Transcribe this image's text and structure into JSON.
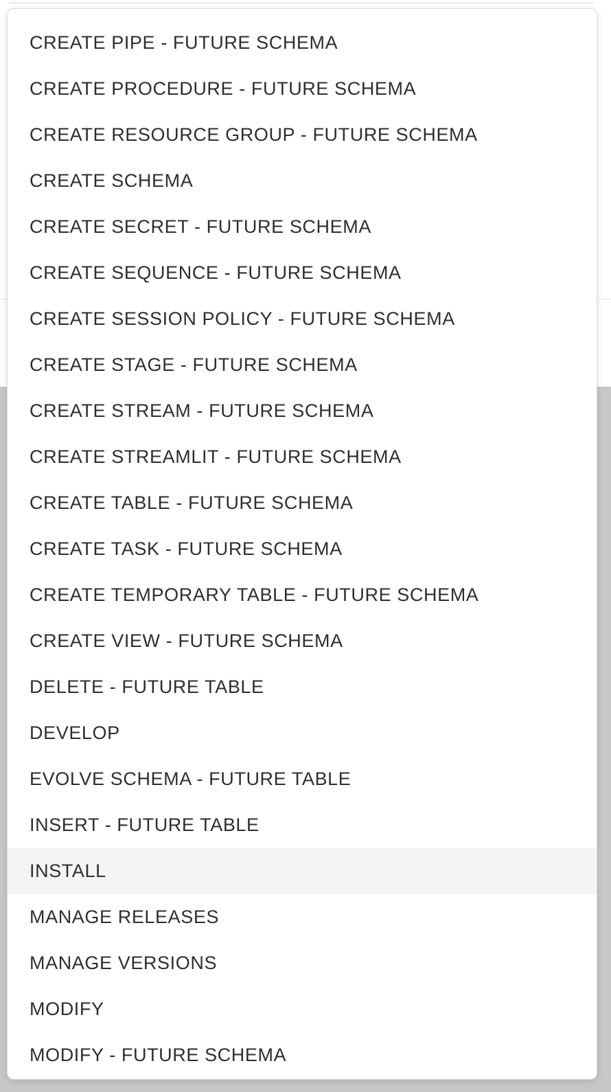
{
  "dropdown": {
    "highlighted_index": 18,
    "items": [
      {
        "label": "CREATE PIPE - FUTURE SCHEMA"
      },
      {
        "label": "CREATE PROCEDURE - FUTURE SCHEMA"
      },
      {
        "label": "CREATE RESOURCE GROUP - FUTURE SCHEMA"
      },
      {
        "label": "CREATE SCHEMA"
      },
      {
        "label": "CREATE SECRET - FUTURE SCHEMA"
      },
      {
        "label": "CREATE SEQUENCE - FUTURE SCHEMA"
      },
      {
        "label": "CREATE SESSION POLICY - FUTURE SCHEMA"
      },
      {
        "label": "CREATE STAGE - FUTURE SCHEMA"
      },
      {
        "label": "CREATE STREAM - FUTURE SCHEMA"
      },
      {
        "label": "CREATE STREAMLIT - FUTURE SCHEMA"
      },
      {
        "label": "CREATE TABLE - FUTURE SCHEMA"
      },
      {
        "label": "CREATE TASK - FUTURE SCHEMA"
      },
      {
        "label": "CREATE TEMPORARY TABLE - FUTURE SCHEMA"
      },
      {
        "label": "CREATE VIEW - FUTURE SCHEMA"
      },
      {
        "label": "DELETE - FUTURE TABLE"
      },
      {
        "label": "DEVELOP"
      },
      {
        "label": "EVOLVE SCHEMA - FUTURE TABLE"
      },
      {
        "label": "INSERT - FUTURE TABLE"
      },
      {
        "label": "INSTALL"
      },
      {
        "label": "MANAGE RELEASES"
      },
      {
        "label": "MANAGE VERSIONS"
      },
      {
        "label": "MODIFY"
      },
      {
        "label": "MODIFY - FUTURE SCHEMA"
      }
    ]
  },
  "colors": {
    "text": "#2b2e33",
    "highlight": "#f4f4f4",
    "overlay": "#c7c7c7"
  }
}
